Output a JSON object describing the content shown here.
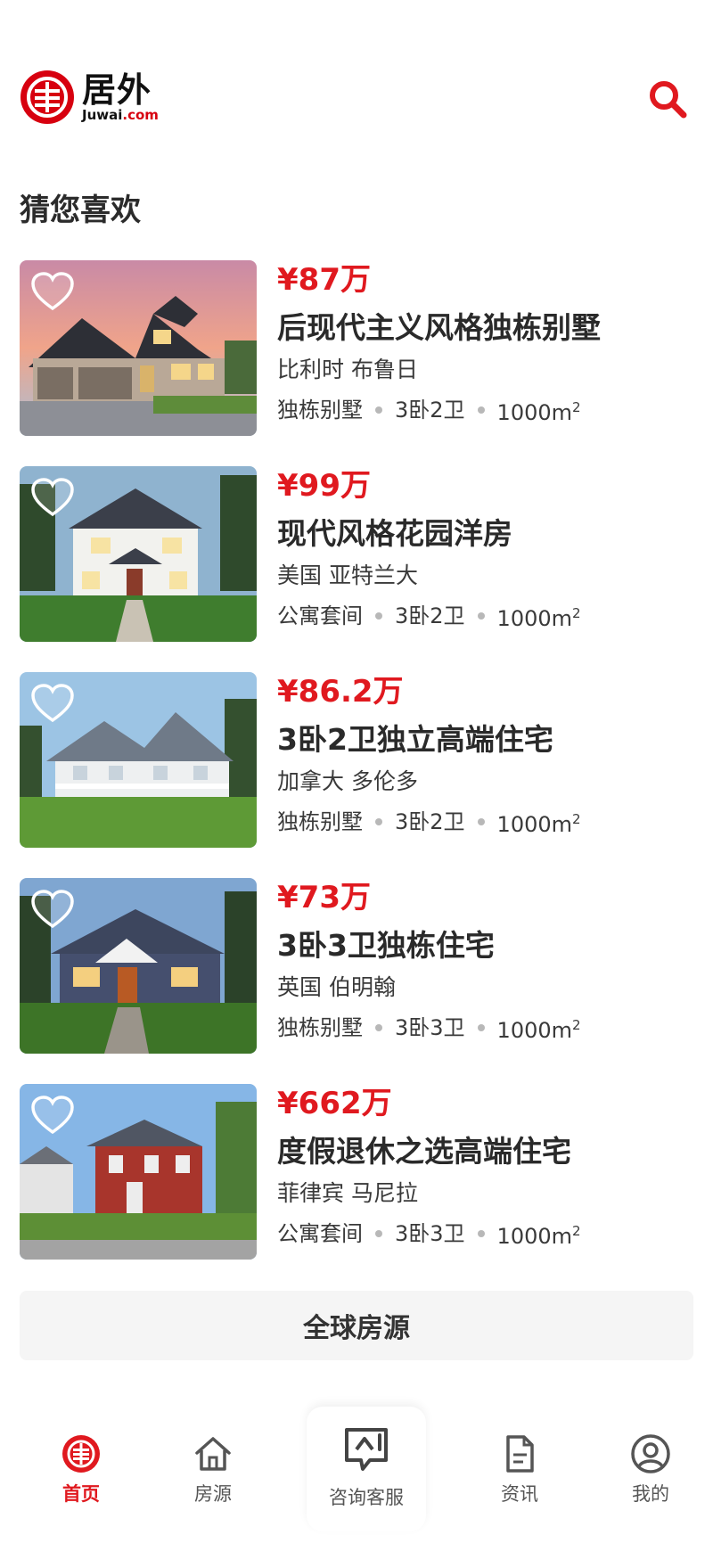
{
  "brand": {
    "name_cn": "居外",
    "name_en_prefix": "Juwai",
    "name_en_suffix": ".com",
    "color": "#d7000f"
  },
  "section_title": "猜您喜欢",
  "listings": [
    {
      "price": "¥87万",
      "title": "后现代主义风格独栋别墅",
      "location": "比利时 布鲁日",
      "type": "独栋别墅",
      "rooms": "3卧2卫",
      "area": "1000m",
      "area_unit": "2",
      "scene": "sunset"
    },
    {
      "price": "¥99万",
      "title": "现代风格花园洋房",
      "location": "美国 亚特兰大",
      "type": "公寓套间",
      "rooms": "3卧2卫",
      "area": "1000m",
      "area_unit": "2",
      "scene": "white"
    },
    {
      "price": "¥86.2万",
      "title": "3卧2卫独立高端住宅",
      "location": "加拿大 多伦多",
      "type": "独栋别墅",
      "rooms": "3卧2卫",
      "area": "1000m",
      "area_unit": "2",
      "scene": "porch"
    },
    {
      "price": "¥73万",
      "title": "3卧3卫独栋住宅",
      "location": "英国 伯明翰",
      "type": "独栋别墅",
      "rooms": "3卧3卫",
      "area": "1000m",
      "area_unit": "2",
      "scene": "navy"
    },
    {
      "price": "¥662万",
      "title": "度假退休之选高端住宅",
      "location": "菲律宾 马尼拉",
      "type": "公寓套间",
      "rooms": "3卧3卫",
      "area": "1000m",
      "area_unit": "2",
      "scene": "red"
    }
  ],
  "all_listings_button": "全球房源",
  "tabs": [
    {
      "label": "首页",
      "icon": "home-logo-icon",
      "active": true
    },
    {
      "label": "房源",
      "icon": "house-icon",
      "active": false
    },
    {
      "label": "咨询客服",
      "icon": "chat-support-icon",
      "active": false
    },
    {
      "label": "资讯",
      "icon": "document-icon",
      "active": false
    },
    {
      "label": "我的",
      "icon": "user-icon",
      "active": false
    }
  ],
  "colors": {
    "accent": "#e0191f",
    "text": "#2a2a2a",
    "button_bg": "#f5f5f5"
  }
}
